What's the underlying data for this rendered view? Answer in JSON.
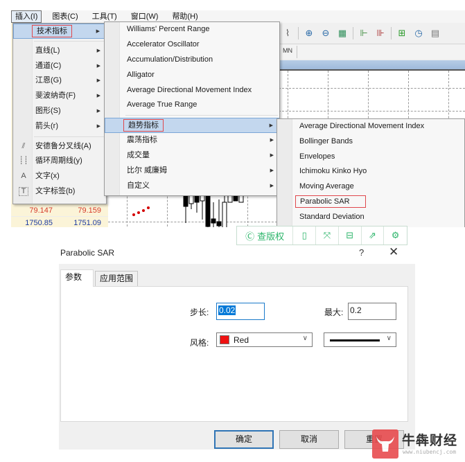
{
  "menubar": {
    "items": [
      "插入(I)",
      "图表(C)",
      "工具(T)",
      "窗口(W)",
      "帮助(H)"
    ],
    "active_index": 0
  },
  "toolbar": {
    "icons": [
      "line-chart-icon",
      "zoom-in-icon",
      "zoom-out-icon",
      "tile-windows-icon",
      "chart-shift-icon",
      "auto-scroll-icon",
      "add-indicator-icon",
      "period-clock-icon",
      "templates-icon"
    ]
  },
  "timeframe_bar": {
    "visible_label": "MN"
  },
  "quotes": [
    {
      "bid": "79.147",
      "ask": "79.159",
      "color": "red"
    },
    {
      "bid": "1750.85",
      "ask": "1751.09",
      "color": "blue"
    }
  ],
  "insert_menu": {
    "items": [
      {
        "label": "技术指标",
        "has_submenu": true,
        "highlighted": true,
        "boxed": true
      },
      {
        "separator": true
      },
      {
        "label": "直线(L)",
        "has_submenu": true
      },
      {
        "label": "通道(C)",
        "has_submenu": true
      },
      {
        "label": "江恩(G)",
        "has_submenu": true
      },
      {
        "label": "斐波纳奇(F)",
        "has_submenu": true
      },
      {
        "label": "图形(S)",
        "has_submenu": true
      },
      {
        "label": "箭头(r)",
        "has_submenu": true
      },
      {
        "separator": true
      },
      {
        "label": "安德鲁分叉线(A)",
        "icon": "andrews-pitchfork-icon",
        "glyph": "⫽"
      },
      {
        "label": "循环周期线(y)",
        "icon": "cycle-lines-icon",
        "glyph": "┊┊"
      },
      {
        "label": "文字(x)",
        "icon": "text-icon",
        "glyph": "A"
      },
      {
        "label": "文字标签(b)",
        "icon": "text-label-icon",
        "glyph": "T"
      }
    ]
  },
  "indicators_menu": {
    "items": [
      {
        "label": "Williams' Percent Range"
      },
      {
        "label": "Accelerator Oscillator"
      },
      {
        "label": "Accumulation/Distribution"
      },
      {
        "label": "Alligator"
      },
      {
        "label": "Average Directional Movement Index"
      },
      {
        "label": "Average True Range"
      },
      {
        "separator": true
      },
      {
        "label": "趋势指标",
        "has_submenu": true,
        "highlighted": true,
        "boxed": true
      },
      {
        "label": "震荡指标",
        "has_submenu": true
      },
      {
        "label": "成交量",
        "has_submenu": true
      },
      {
        "label": "比尔 威廉姆",
        "has_submenu": true
      },
      {
        "label": "自定义",
        "has_submenu": true
      }
    ]
  },
  "trend_menu": {
    "items": [
      {
        "label": "Average Directional Movement Index"
      },
      {
        "label": "Bollinger Bands"
      },
      {
        "label": "Envelopes"
      },
      {
        "label": "Ichimoku Kinko Hyo"
      },
      {
        "label": "Moving Average"
      },
      {
        "label": "Parabolic SAR",
        "boxed": true
      },
      {
        "label": "Standard Deviation"
      }
    ]
  },
  "watermark_toolbar": {
    "copyright_label": "查版权",
    "icons": [
      "tablet-icon",
      "fullscreen-icon",
      "save-icon",
      "share-icon",
      "settings-icon"
    ]
  },
  "dialog": {
    "title": "Parabolic SAR",
    "help": "?",
    "close": "✕",
    "tabs": [
      {
        "label": "参数",
        "active": true
      },
      {
        "label": "应用范围",
        "active": false
      }
    ],
    "step_label": "步长:",
    "step_value": "0.02",
    "max_label": "最大:",
    "max_value": "0.2",
    "style_label": "风格:",
    "color_name": "Red",
    "color_hex": "#ee1111",
    "line_style": "solid",
    "buttons": {
      "ok": "确定",
      "cancel": "取消",
      "reset": "重置"
    }
  },
  "logo": {
    "name": "牛犇财经",
    "url": "www.niubencj.com"
  }
}
